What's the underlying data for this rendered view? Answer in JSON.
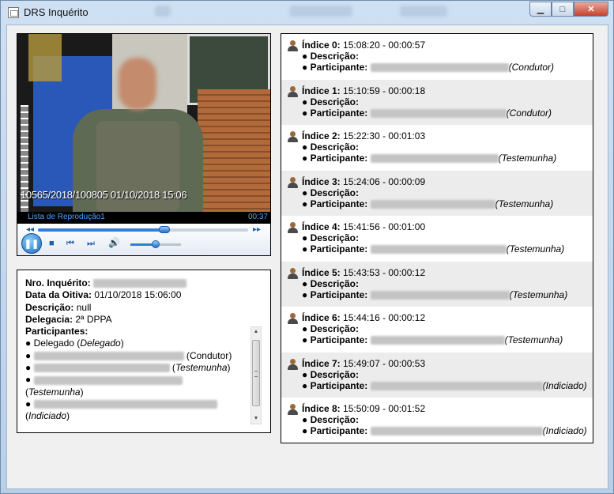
{
  "window": {
    "title": "DRS Inquérito"
  },
  "titlebar_buttons": {
    "minimize": "▁",
    "maximize": "□",
    "close": "✕"
  },
  "player": {
    "timestamp_overlay": "10565/2018/100805 01/10/2018 15:06",
    "playlist_label": "Lista de Reprodução1",
    "elapsed": "00:37",
    "progress_fraction": 0.6,
    "volume_fraction": 0.5,
    "prev_icon": "◂◂",
    "next_icon": "▸▸",
    "play_pause_icon": "❚❚",
    "stop_icon": "■",
    "previous_track_icon": "⏮",
    "next_track_icon": "⏭",
    "volume_icon": "🔊"
  },
  "info": {
    "nro_label": "Nro. Inquérito:",
    "data_label": "Data da Oitiva:",
    "data_value": "01/10/2018 15:06:00",
    "descricao_label": "Descrição:",
    "descricao_value": "null",
    "delegacia_label": "Delegacia:",
    "delegacia_value": "2ª DPPA",
    "participantes_label": "Participantes:",
    "participants": [
      {
        "bullet": "●",
        "name": "Delegado",
        "role": "Delegado"
      },
      {
        "bullet": "●",
        "role": "Condutor"
      },
      {
        "bullet": "●",
        "role": "Testemunha"
      },
      {
        "bullet": "●",
        "role": "Testemunha"
      },
      {
        "bullet": "●",
        "role": "Indiciado"
      }
    ],
    "scroll_up": "▲",
    "scroll_down": "▼"
  },
  "indices": [
    {
      "label": "Índice 0:",
      "time": "15:08:20 - 00:00:57",
      "descricao_label": "Descrição:",
      "participante_label": "Participante:",
      "role": "(Condutor)"
    },
    {
      "label": "Índice 1:",
      "time": "15:10:59 - 00:00:18",
      "descricao_label": "Descrição:",
      "participante_label": "Participante:",
      "role": "(Condutor)"
    },
    {
      "label": "Índice 2:",
      "time": "15:22:30 - 00:01:03",
      "descricao_label": "Descrição:",
      "participante_label": "Participante:",
      "role": "(Testemunha)"
    },
    {
      "label": "Índice 3:",
      "time": "15:24:06 - 00:00:09",
      "descricao_label": "Descrição:",
      "participante_label": "Participante:",
      "role": "(Testemunha)"
    },
    {
      "label": "Índice 4:",
      "time": "15:41:56 - 00:01:00",
      "descricao_label": "Descrição:",
      "participante_label": "Participante:",
      "role": "(Testemunha)"
    },
    {
      "label": "Índice 5:",
      "time": "15:43:53 - 00:00:12",
      "descricao_label": "Descrição:",
      "participante_label": "Participante:",
      "role": "(Testemunha)"
    },
    {
      "label": "Índice 6:",
      "time": "15:44:16 - 00:00:12",
      "descricao_label": "Descrição:",
      "participante_label": "Participante:",
      "role": "(Testemunha)"
    },
    {
      "label": "Índice 7:",
      "time": "15:49:07 - 00:00:53",
      "descricao_label": "Descrição:",
      "participante_label": "Participante:",
      "role": "(Indiciado)"
    },
    {
      "label": "Índice 8:",
      "time": "15:50:09 - 00:01:52",
      "descricao_label": "Descrição:",
      "participante_label": "Participante:",
      "role": "(Indiciado)"
    }
  ],
  "index_bullet": "●"
}
